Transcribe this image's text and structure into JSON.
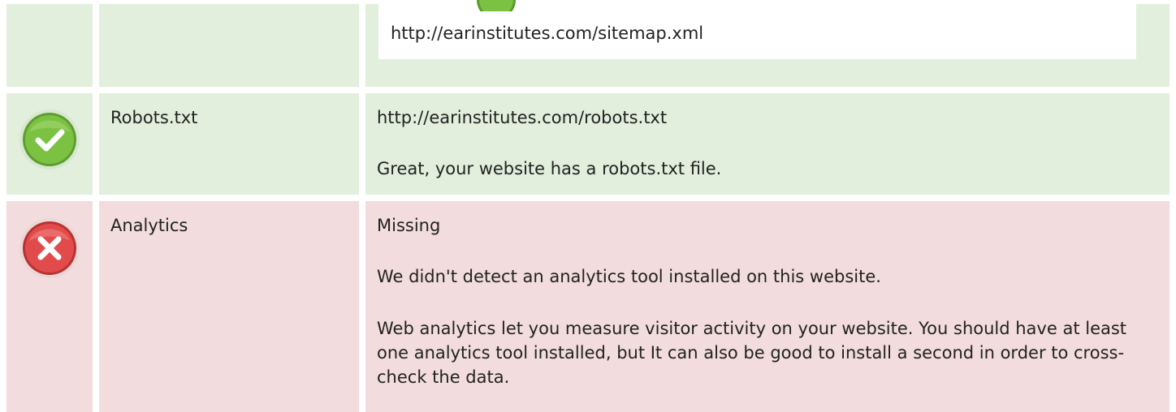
{
  "sitemap": {
    "url": "http://earinstitutes.com/sitemap.xml",
    "status_icon": "check-icon"
  },
  "robots": {
    "label": "Robots.txt",
    "url": "http://earinstitutes.com/robots.txt",
    "message": "Great, your website has a robots.txt file.",
    "status_icon": "check-icon"
  },
  "analytics": {
    "label": "Analytics",
    "status": "Missing",
    "message": "We didn't detect an analytics tool installed on this website.",
    "description": "Web analytics let you measure visitor activity on your website. You should have at least one analytics tool installed, but It can also be good to install a second in order to cross-check the data.",
    "status_icon": "error-x-icon"
  },
  "colors": {
    "success_row": "#e1efdc",
    "error_row": "#f2dcdd",
    "success_icon": "#7cc242",
    "error_icon": "#e24b4b"
  }
}
